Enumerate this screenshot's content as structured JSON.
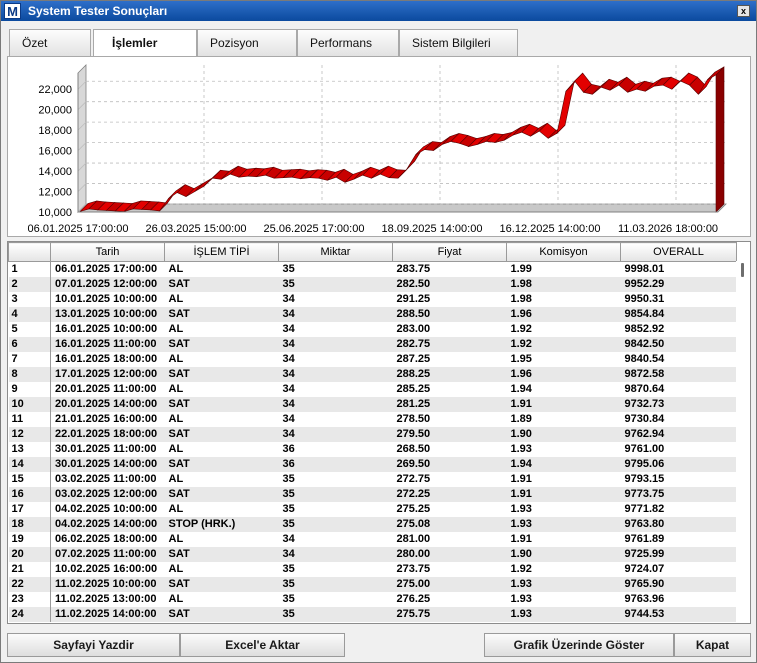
{
  "window": {
    "title": "System Tester Sonuçları",
    "icon_letter": "M",
    "close": "x"
  },
  "tabs": [
    "Özet",
    "İşlemler",
    "Pozisyon",
    "Performans",
    "Sistem Bilgileri"
  ],
  "active_tab": "İşlemler",
  "chart_data": {
    "type": "area",
    "x_ticks": [
      "06.01.2025 17:00:00",
      "26.03.2025 15:00:00",
      "25.06.2025 17:00:00",
      "18.09.2025 14:00:00",
      "16.12.2025 14:00:00",
      "11.03.2026 18:00:00"
    ],
    "y_ticks": [
      "10,000",
      "12,000",
      "14,000",
      "16,000",
      "18,000",
      "20,000",
      "22,000"
    ],
    "ylim": [
      10000,
      23000
    ],
    "grid": true,
    "color": "#e00000",
    "values": [
      10050,
      10300,
      10200,
      10150,
      10100,
      10050,
      10300,
      10250,
      10200,
      10100,
      11300,
      11900,
      11500,
      12000,
      12500,
      13300,
      13200,
      13700,
      13400,
      13500,
      13450,
      13600,
      13300,
      13350,
      13400,
      13250,
      13350,
      13300,
      13100,
      13400,
      12900,
      13200,
      13600,
      13300,
      13700,
      13350,
      13300,
      14200,
      15600,
      16100,
      16000,
      16600,
      16900,
      16700,
      16400,
      16600,
      16900,
      16800,
      17000,
      17500,
      17800,
      17400,
      17900,
      17200,
      17700,
      21800,
      22800,
      21700,
      21500,
      22200,
      21900,
      22400,
      21700,
      22000,
      21800,
      22300,
      22400,
      22000,
      22800,
      22400,
      21500,
      22900,
      23400
    ]
  },
  "table": {
    "columns": [
      "",
      "Tarih",
      "İŞLEM TİPİ",
      "Miktar",
      "Fiyat",
      "Komisyon",
      "OVERALL"
    ],
    "rows": [
      [
        "1",
        "06.01.2025 17:00:00",
        "AL",
        "35",
        "283.75",
        "1.99",
        "9998.01"
      ],
      [
        "2",
        "07.01.2025 12:00:00",
        "SAT",
        "35",
        "282.50",
        "1.98",
        "9952.29"
      ],
      [
        "3",
        "10.01.2025 10:00:00",
        "AL",
        "34",
        "291.25",
        "1.98",
        "9950.31"
      ],
      [
        "4",
        "13.01.2025 10:00:00",
        "SAT",
        "34",
        "288.50",
        "1.96",
        "9854.84"
      ],
      [
        "5",
        "16.01.2025 10:00:00",
        "AL",
        "34",
        "283.00",
        "1.92",
        "9852.92"
      ],
      [
        "6",
        "16.01.2025 11:00:00",
        "SAT",
        "34",
        "282.75",
        "1.92",
        "9842.50"
      ],
      [
        "7",
        "16.01.2025 18:00:00",
        "AL",
        "34",
        "287.25",
        "1.95",
        "9840.54"
      ],
      [
        "8",
        "17.01.2025 12:00:00",
        "SAT",
        "34",
        "288.25",
        "1.96",
        "9872.58"
      ],
      [
        "9",
        "20.01.2025 11:00:00",
        "AL",
        "34",
        "285.25",
        "1.94",
        "9870.64"
      ],
      [
        "10",
        "20.01.2025 14:00:00",
        "SAT",
        "34",
        "281.25",
        "1.91",
        "9732.73"
      ],
      [
        "11",
        "21.01.2025 16:00:00",
        "AL",
        "34",
        "278.50",
        "1.89",
        "9730.84"
      ],
      [
        "12",
        "22.01.2025 18:00:00",
        "SAT",
        "34",
        "279.50",
        "1.90",
        "9762.94"
      ],
      [
        "13",
        "30.01.2025 11:00:00",
        "AL",
        "36",
        "268.50",
        "1.93",
        "9761.00"
      ],
      [
        "14",
        "30.01.2025 14:00:00",
        "SAT",
        "36",
        "269.50",
        "1.94",
        "9795.06"
      ],
      [
        "15",
        "03.02.2025 11:00:00",
        "AL",
        "35",
        "272.75",
        "1.91",
        "9793.15"
      ],
      [
        "16",
        "03.02.2025 12:00:00",
        "SAT",
        "35",
        "272.25",
        "1.91",
        "9773.75"
      ],
      [
        "17",
        "04.02.2025 10:00:00",
        "AL",
        "35",
        "275.25",
        "1.93",
        "9771.82"
      ],
      [
        "18",
        "04.02.2025 14:00:00",
        "STOP (HRK.)",
        "35",
        "275.08",
        "1.93",
        "9763.80"
      ],
      [
        "19",
        "06.02.2025 18:00:00",
        "AL",
        "34",
        "281.00",
        "1.91",
        "9761.89"
      ],
      [
        "20",
        "07.02.2025 11:00:00",
        "SAT",
        "34",
        "280.00",
        "1.90",
        "9725.99"
      ],
      [
        "21",
        "10.02.2025 16:00:00",
        "AL",
        "35",
        "273.75",
        "1.92",
        "9724.07"
      ],
      [
        "22",
        "11.02.2025 10:00:00",
        "SAT",
        "35",
        "275.00",
        "1.93",
        "9765.90"
      ],
      [
        "23",
        "11.02.2025 13:00:00",
        "AL",
        "35",
        "276.25",
        "1.93",
        "9763.96"
      ],
      [
        "24",
        "11.02.2025 14:00:00",
        "SAT",
        "35",
        "275.75",
        "1.93",
        "9744.53"
      ]
    ]
  },
  "buttons": {
    "print": "Sayfayi Yazdir",
    "excel": "Excel'e Aktar",
    "show_on_chart": "Grafik Üzerinde Göster",
    "close": "Kapat"
  }
}
